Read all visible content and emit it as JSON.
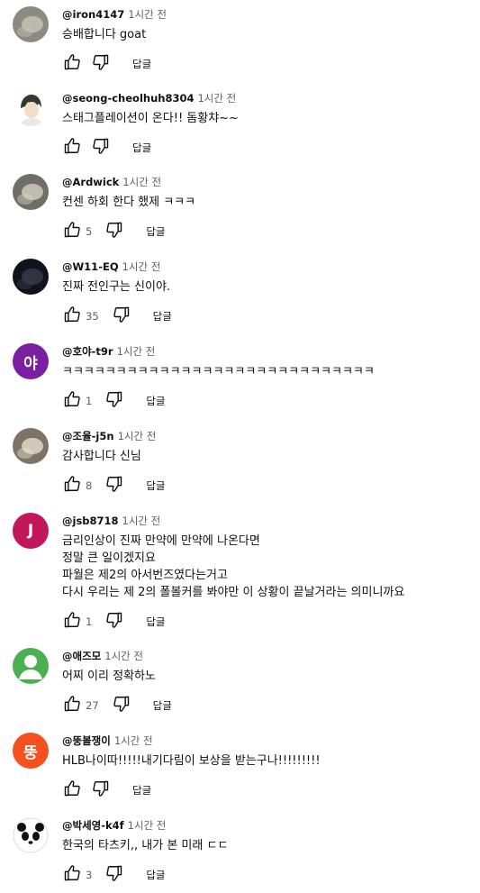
{
  "comments": [
    {
      "author": "@iron4147",
      "time": "1시간 전",
      "lines": [
        "승배합니다 goat"
      ],
      "likes": "",
      "reply_label": "답글",
      "avatar": {
        "kind": "photo",
        "bg": "#8c8a82",
        "fg": "#c9c4b6"
      }
    },
    {
      "author": "@seong-cheolhuh8304",
      "time": "1시간 전",
      "lines": [
        "스태그플레이션이 온다!! 돔황챠~~"
      ],
      "likes": "",
      "reply_label": "답글",
      "avatar": {
        "kind": "anime",
        "bg": "#ffffff",
        "fg": "#2e3b2e"
      }
    },
    {
      "author": "@Ardwick",
      "time": "1시간 전",
      "lines": [
        "컨센 하회 한다 했제 ㅋㅋㅋ"
      ],
      "likes": "5",
      "reply_label": "답글",
      "avatar": {
        "kind": "photo",
        "bg": "#6f6e69",
        "fg": "#d6d0c2"
      }
    },
    {
      "author": "@W11-EQ",
      "time": "1시간 전",
      "lines": [
        "진짜 전인구는 신이야."
      ],
      "likes": "35",
      "reply_label": "답글",
      "avatar": {
        "kind": "photo",
        "bg": "#11131c",
        "fg": "#3a3c4a"
      }
    },
    {
      "author": "@호야-t9r",
      "time": "1시간 전",
      "lines": [
        "ㅋㅋㅋㅋㅋㅋㅋㅋㅋㅋㅋㅋㅋㅋㅋㅋㅋㅋㅋㅋㅋㅋㅋㅋㅋㅋㅋㅋㅋ"
      ],
      "likes": "1",
      "reply_label": "답글",
      "avatar": {
        "kind": "letter",
        "letter": "야",
        "bg": "#7b1fa2"
      }
    },
    {
      "author": "@조율-j5n",
      "time": "1시간 전",
      "lines": [
        "감사합니다 신님"
      ],
      "likes": "8",
      "reply_label": "답글",
      "avatar": {
        "kind": "photo",
        "bg": "#7d7466",
        "fg": "#e7dfd1"
      }
    },
    {
      "author": "@jsb8718",
      "time": "1시간 전",
      "lines": [
        "금리인상이 진짜 만약에 만약에 나온다면",
        "정말 큰 일이겠지요",
        "파월은 제2의 아서번즈였다는거고",
        "다시 우리는 제 2의 폴볼커를 봐야만 이 상황이 끝날거라는 의미니까요"
      ],
      "likes": "1",
      "reply_label": "답글",
      "avatar": {
        "kind": "letter",
        "letter": "J",
        "bg": "#c2185b"
      }
    },
    {
      "author": "@애즈모",
      "time": "1시간 전",
      "lines": [
        "어찌 이리 정확하노"
      ],
      "likes": "27",
      "reply_label": "답글",
      "avatar": {
        "kind": "default",
        "bg": "#4caf50"
      }
    },
    {
      "author": "@뚱볼쟁이",
      "time": "1시간 전",
      "lines": [
        "HLB나이따!!!!!내기다림이 보상을 받는구나!!!!!!!!!"
      ],
      "likes": "",
      "reply_label": "답글",
      "avatar": {
        "kind": "letter",
        "letter": "뚱",
        "bg": "#f4511e"
      }
    },
    {
      "author": "@박세영-k4f",
      "time": "1시간 전",
      "lines": [
        "한국의 타츠키,, 내가 본 미래 ㄷㄷ"
      ],
      "likes": "3",
      "reply_label": "답글",
      "avatar": {
        "kind": "panda",
        "bg": "#ffffff",
        "fg": "#111111"
      }
    }
  ]
}
